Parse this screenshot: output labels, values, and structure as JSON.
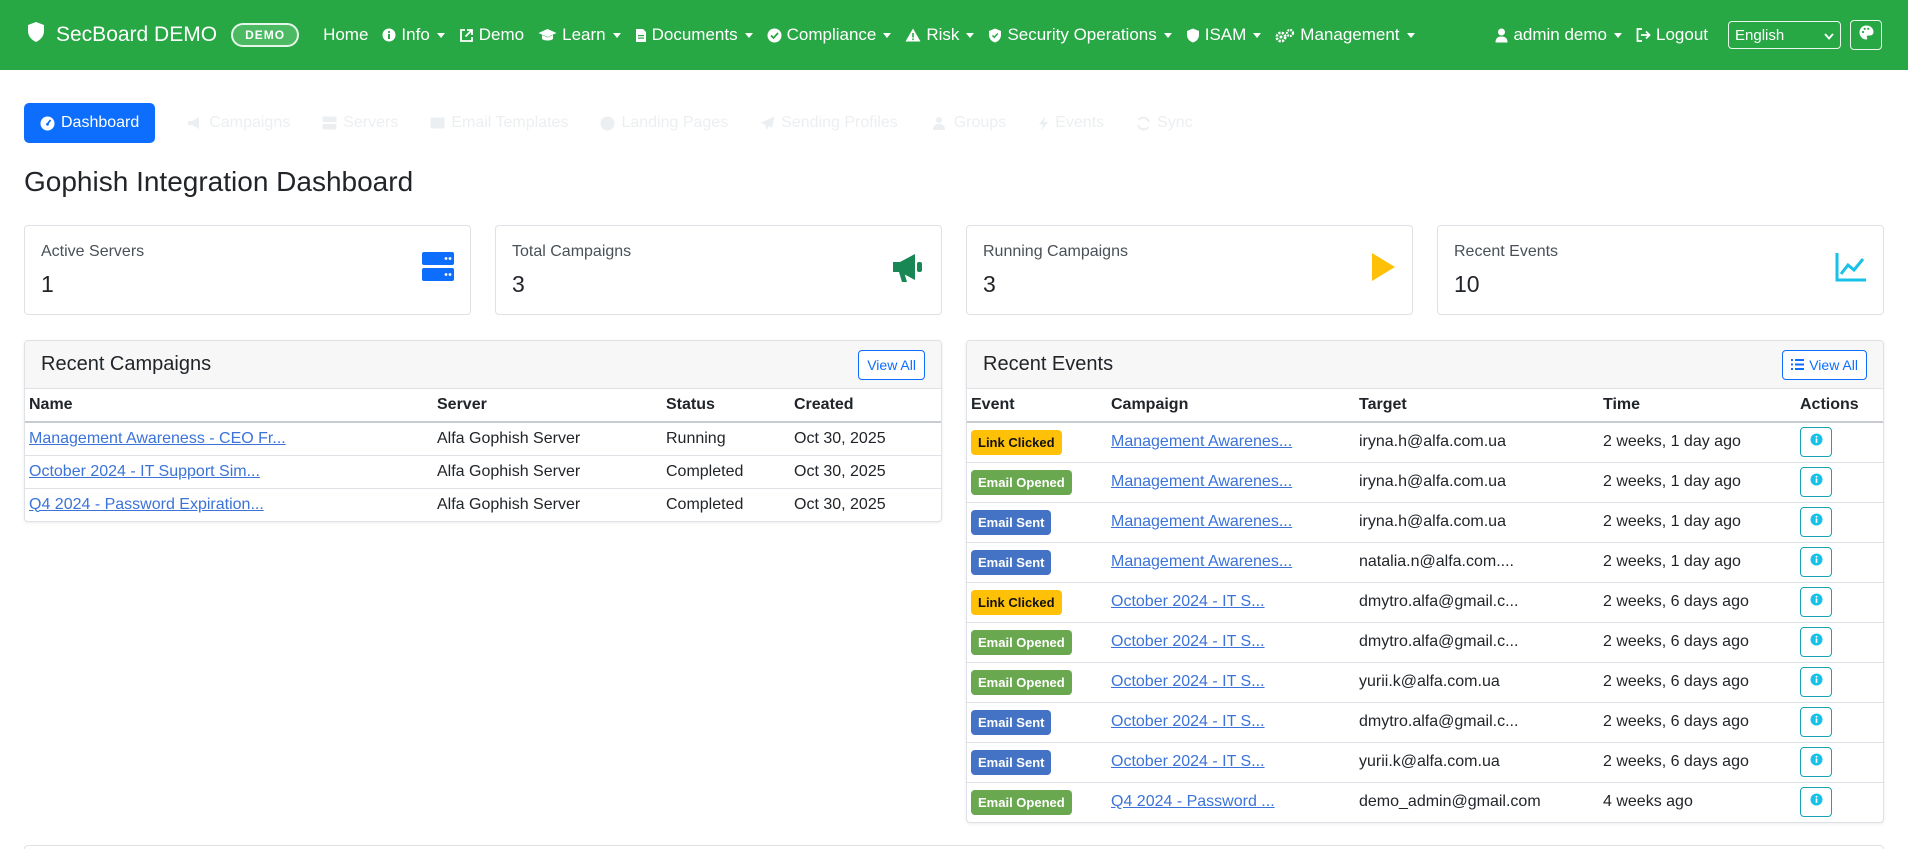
{
  "navbar": {
    "brand": "SecBoard DEMO",
    "demo_badge": "DEMO",
    "items": [
      {
        "label": "Home",
        "icon": "none"
      },
      {
        "label": "Info",
        "icon": "info-circle-icon"
      },
      {
        "label": "Demo",
        "icon": "external-link-icon"
      },
      {
        "label": "Learn",
        "icon": "graduation-cap-icon"
      },
      {
        "label": "Documents",
        "icon": "file-icon"
      },
      {
        "label": "Compliance",
        "icon": "check-circle-icon"
      },
      {
        "label": "Risk",
        "icon": "warning-triangle-icon"
      },
      {
        "label": "Security Operations",
        "icon": "shield-icon"
      },
      {
        "label": "ISAM",
        "icon": "shield-icon"
      },
      {
        "label": "Management",
        "icon": "gears-icon"
      }
    ],
    "user": "admin demo",
    "logout": "Logout",
    "language": "English"
  },
  "tabs": [
    {
      "label": "Dashboard",
      "icon": "gauge-icon",
      "active": true
    },
    {
      "label": "Campaigns",
      "icon": "megaphone-icon"
    },
    {
      "label": "Servers",
      "icon": "server-icon"
    },
    {
      "label": "Email Templates",
      "icon": "envelope-icon"
    },
    {
      "label": "Landing Pages",
      "icon": "globe-icon"
    },
    {
      "label": "Sending Profiles",
      "icon": "paper-plane-icon"
    },
    {
      "label": "Groups",
      "icon": "users-icon"
    },
    {
      "label": "Events",
      "icon": "bolt-icon"
    },
    {
      "label": "Sync",
      "icon": "sync-icon"
    }
  ],
  "page_title": "Gophish Integration Dashboard",
  "stats": [
    {
      "label": "Active Servers",
      "value": "1",
      "icon": "server-icon",
      "color": "#0d6efd"
    },
    {
      "label": "Total Campaigns",
      "value": "3",
      "icon": "megaphone-icon",
      "color": "#198754"
    },
    {
      "label": "Running Campaigns",
      "value": "3",
      "icon": "play-icon",
      "color": "#ffc107"
    },
    {
      "label": "Recent Events",
      "value": "10",
      "icon": "chart-line-icon",
      "color": "#17c1e8"
    }
  ],
  "recent_campaigns": {
    "title": "Recent Campaigns",
    "view_all": "View All",
    "columns": [
      "Name",
      "Server",
      "Status",
      "Created"
    ],
    "rows": [
      {
        "name": "Management Awareness - CEO Fr...",
        "server": "Alfa Gophish Server",
        "status": "Running",
        "created": "Oct 30, 2025"
      },
      {
        "name": "October 2024 - IT Support Sim...",
        "server": "Alfa Gophish Server",
        "status": "Completed",
        "created": "Oct 30, 2025"
      },
      {
        "name": "Q4 2024 - Password Expiration...",
        "server": "Alfa Gophish Server",
        "status": "Completed",
        "created": "Oct 30, 2025"
      }
    ]
  },
  "recent_events": {
    "title": "Recent Events",
    "view_all": "View All",
    "columns": [
      "Event",
      "Campaign",
      "Target",
      "Time",
      "Actions"
    ],
    "rows": [
      {
        "event": "Link Clicked",
        "type": "clicked",
        "campaign": "Management Awarenes...",
        "target": "iryna.h@alfa.com.ua",
        "time": "2 weeks, 1 day ago"
      },
      {
        "event": "Email Opened",
        "type": "opened",
        "campaign": "Management Awarenes...",
        "target": "iryna.h@alfa.com.ua",
        "time": "2 weeks, 1 day ago"
      },
      {
        "event": "Email Sent",
        "type": "sent",
        "campaign": "Management Awarenes...",
        "target": "iryna.h@alfa.com.ua",
        "time": "2 weeks, 1 day ago"
      },
      {
        "event": "Email Sent",
        "type": "sent",
        "campaign": "Management Awarenes...",
        "target": "natalia.n@alfa.com....",
        "time": "2 weeks, 1 day ago"
      },
      {
        "event": "Link Clicked",
        "type": "clicked",
        "campaign": "October 2024 - IT S...",
        "target": "dmytro.alfa@gmail.c...",
        "time": "2 weeks, 6 days ago"
      },
      {
        "event": "Email Opened",
        "type": "opened",
        "campaign": "October 2024 - IT S...",
        "target": "dmytro.alfa@gmail.c...",
        "time": "2 weeks, 6 days ago"
      },
      {
        "event": "Email Opened",
        "type": "opened",
        "campaign": "October 2024 - IT S...",
        "target": "yurii.k@alfa.com.ua",
        "time": "2 weeks, 6 days ago"
      },
      {
        "event": "Email Sent",
        "type": "sent",
        "campaign": "October 2024 - IT S...",
        "target": "dmytro.alfa@gmail.c...",
        "time": "2 weeks, 6 days ago"
      },
      {
        "event": "Email Sent",
        "type": "sent",
        "campaign": "October 2024 - IT S...",
        "target": "yurii.k@alfa.com.ua",
        "time": "2 weeks, 6 days ago"
      },
      {
        "event": "Email Opened",
        "type": "opened",
        "campaign": "Q4 2024 - Password ...",
        "target": "demo_admin@gmail.com",
        "time": "4 weeks ago"
      }
    ]
  }
}
